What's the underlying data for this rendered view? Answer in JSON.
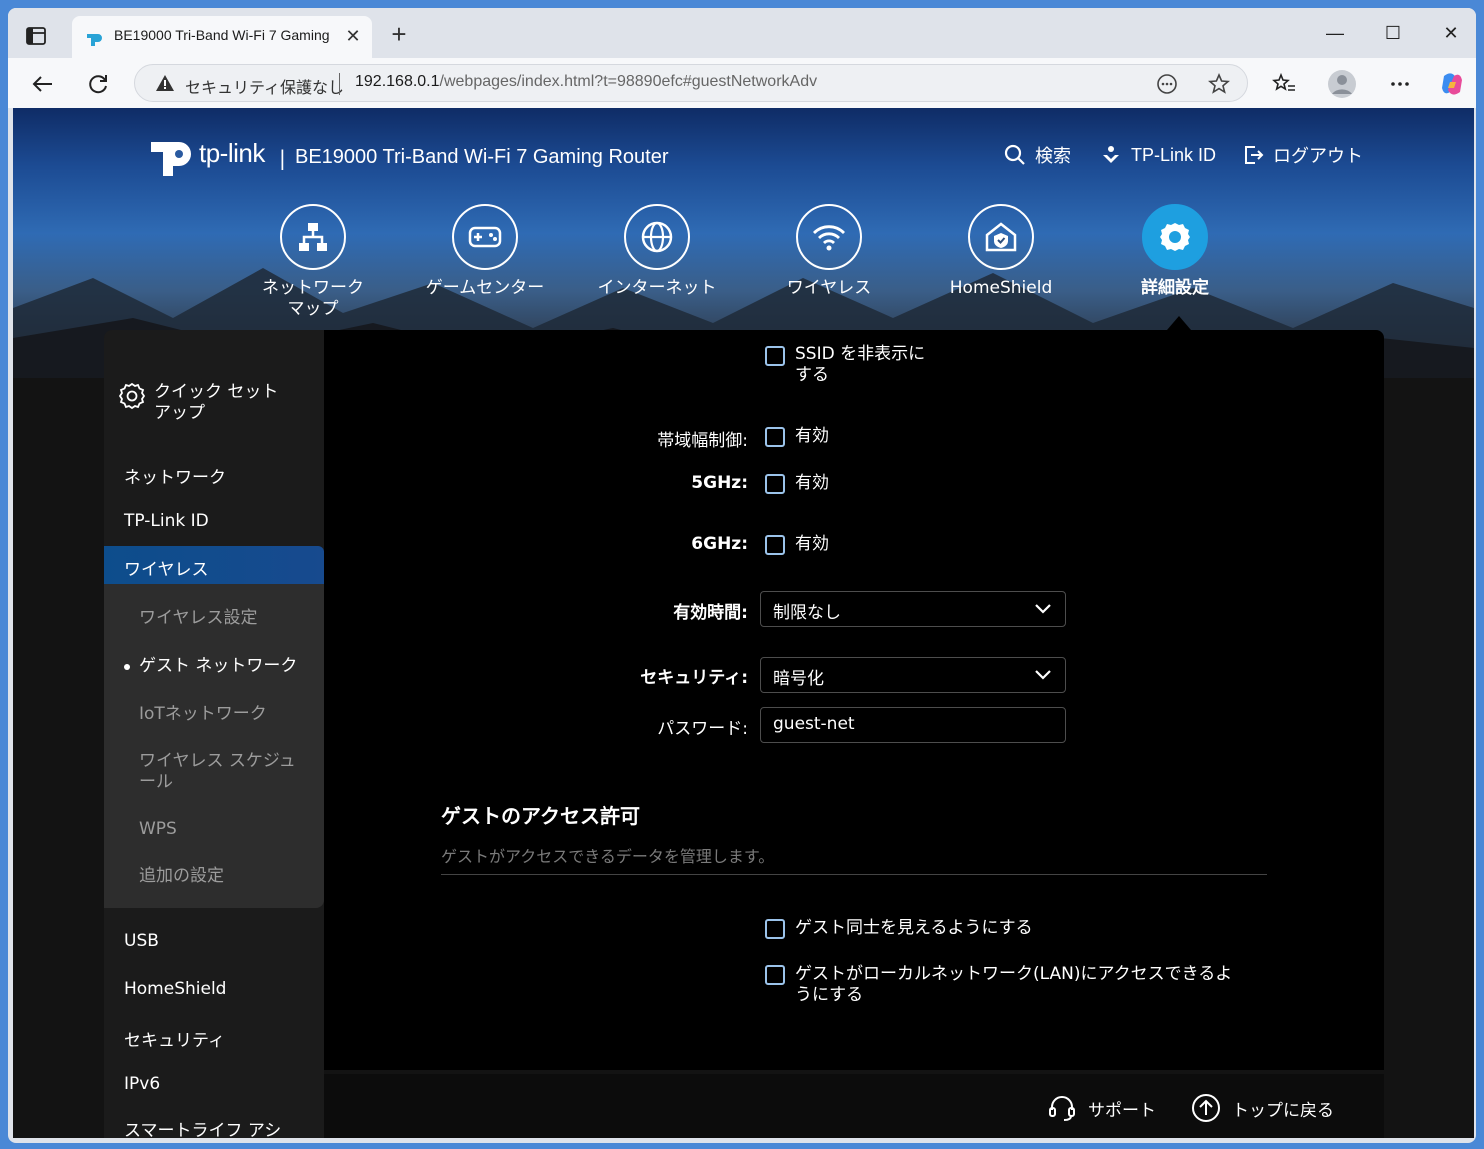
{
  "browser": {
    "tab_title": "BE19000 Tri-Band Wi-Fi 7 Gaming",
    "tab_close": "✕",
    "new_tab": "+",
    "security_text": "セキュリティ保護なし",
    "url_host": "192.168.0.1",
    "url_path": "/webpages/index.html?t=98890efc#guestNetworkAdv",
    "minimize": "—",
    "maximize": "☐",
    "close": "✕"
  },
  "header": {
    "logo_text": "tp-link",
    "separator": "|",
    "model": "BE19000 Tri-Band Wi-Fi 7 Gaming Router",
    "search": "検索",
    "tplink_id": "TP-Link ID",
    "logout": "ログアウト"
  },
  "nav": [
    {
      "label": "ネットワーク\nマップ",
      "icon": "network-map-icon"
    },
    {
      "label": "ゲームセンター",
      "icon": "gamepad-icon"
    },
    {
      "label": "インターネット",
      "icon": "globe-icon"
    },
    {
      "label": "ワイヤレス",
      "icon": "wifi-icon"
    },
    {
      "label": "HomeShield",
      "icon": "home-shield-icon"
    },
    {
      "label": "詳細設定",
      "icon": "gear-icon",
      "active": true
    }
  ],
  "sidebar": {
    "quick_setup": "クイック セット\nアップ",
    "network": "ネットワーク",
    "tplink_id": "TP-Link ID",
    "wireless": "ワイヤレス",
    "sub": {
      "wireless_settings": "ワイヤレス設定",
      "guest_network": "ゲスト ネットワーク",
      "iot_network": "IoTネットワーク",
      "wireless_schedule": "ワイヤレス スケジュ\nール",
      "wps": "WPS",
      "additional": "追加の設定"
    },
    "usb": "USB",
    "homeshield": "HomeShield",
    "security": "セキュリティ",
    "ipv6": "IPv6",
    "smart_life": "スマートライフ アシ\nスタント"
  },
  "form": {
    "hide_ssid": "SSID を非表示に\nする",
    "bandwidth_label": "帯域幅制御:",
    "bandwidth_value": "有効",
    "ghz5_label": "5GHz:",
    "ghz5_value": "有効",
    "ghz6_label": "6GHz:",
    "ghz6_value": "有効",
    "time_label": "有効時間:",
    "time_value": "制限なし",
    "security_label": "セキュリティ:",
    "security_value": "暗号化",
    "password_label": "パスワード:",
    "password_value": "guest-net"
  },
  "access": {
    "title": "ゲストのアクセス許可",
    "description": "ゲストがアクセスできるデータを管理します。",
    "see_each_other": "ゲスト同士を見えるようにする",
    "access_lan": "ゲストがローカルネットワーク(LAN)にアクセスできるよ\nうにする"
  },
  "footer": {
    "support": "サポート",
    "back_to_top": "トップに戻る"
  },
  "colors": {
    "accent": "#1e9fe0",
    "checkbox_border": "#9bc3ea",
    "sidebar_active": "#0d4d8c"
  }
}
